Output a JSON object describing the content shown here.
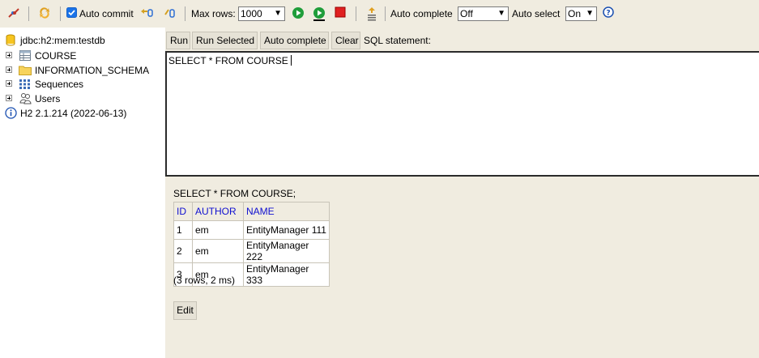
{
  "toolbar": {
    "auto_commit_label": "Auto commit",
    "auto_commit_checked": true,
    "max_rows_label": "Max rows:",
    "max_rows_value": "1000",
    "auto_complete_label": "Auto complete",
    "auto_complete_value": "Off",
    "auto_select_label": "Auto select",
    "auto_select_value": "On",
    "help_label": "?",
    "icons": [
      "disconnect-icon",
      "refresh-icon",
      "rollback-icon",
      "commit-icon",
      "run-icon",
      "run-selected-icon",
      "stop-icon",
      "history-icon",
      "help-icon"
    ]
  },
  "tree": {
    "connection": "jdbc:h2:mem:testdb",
    "items": [
      {
        "label": "COURSE",
        "icon": "table-icon"
      },
      {
        "label": "INFORMATION_SCHEMA",
        "icon": "folder-icon"
      },
      {
        "label": "Sequences",
        "icon": "sequence-icon"
      },
      {
        "label": "Users",
        "icon": "users-icon"
      }
    ],
    "version": "H2 2.1.214 (2022-06-13)"
  },
  "editor": {
    "buttons": {
      "run": "Run",
      "run_selected": "Run Selected",
      "auto_complete": "Auto complete",
      "clear": "Clear"
    },
    "sql_label": "SQL statement:",
    "sql_text": "SELECT * FROM COURSE"
  },
  "result": {
    "query": "SELECT * FROM COURSE;",
    "columns": [
      "ID",
      "AUTHOR",
      "NAME"
    ],
    "rows": [
      [
        "1",
        "em",
        "EntityManager 111"
      ],
      [
        "2",
        "em",
        "EntityManager 222"
      ],
      [
        "3",
        "em",
        "EntityManager 333"
      ]
    ],
    "status": "(3 rows, 2 ms)",
    "edit_label": "Edit"
  }
}
